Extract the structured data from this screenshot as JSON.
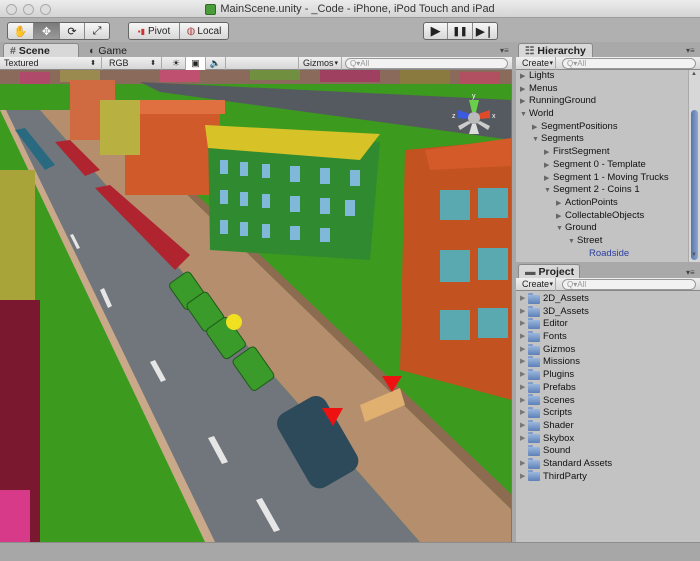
{
  "window": {
    "title": "MainScene.unity - _Code - iPhone, iPod Touch and iPad"
  },
  "toolbar": {
    "tools": [
      {
        "name": "hand-tool",
        "icon": "✋",
        "active": false
      },
      {
        "name": "move-tool",
        "icon": "✥",
        "active": true
      },
      {
        "name": "rotate-tool",
        "icon": "⟳",
        "active": false
      },
      {
        "name": "scale-tool",
        "icon": "⤢",
        "active": false
      }
    ],
    "pivot_label": "Pivot",
    "local_label": "Local",
    "play_icon": "▶",
    "pause_icon": "❚❚",
    "step_icon": "▶❘"
  },
  "scene_panel": {
    "tabs": [
      {
        "label": "Scene",
        "icon": "#",
        "active": true
      },
      {
        "label": "Game",
        "icon": "◐",
        "active": false
      }
    ],
    "render_mode": "Textured",
    "color_mode": "RGB",
    "gizmos_label": "Gizmos",
    "search_placeholder": "Q▾All",
    "gizmo_axes": {
      "y": "y",
      "x": "x",
      "z": "z"
    }
  },
  "hierarchy": {
    "tab_label": "Hierarchy",
    "create_label": "Create",
    "search_placeholder": "Q▾All",
    "items": [
      {
        "label": "Lights",
        "depth": 0,
        "expand": "collapsed"
      },
      {
        "label": "Menus",
        "depth": 0,
        "expand": "collapsed"
      },
      {
        "label": "RunningGround",
        "depth": 0,
        "expand": "collapsed"
      },
      {
        "label": "World",
        "depth": 0,
        "expand": "expanded"
      },
      {
        "label": "SegmentPositions",
        "depth": 1,
        "expand": "collapsed"
      },
      {
        "label": "Segments",
        "depth": 1,
        "expand": "expanded"
      },
      {
        "label": "FirstSegment",
        "depth": 2,
        "expand": "collapsed"
      },
      {
        "label": "Segment 0 - Template",
        "depth": 2,
        "expand": "collapsed"
      },
      {
        "label": "Segment 1 - Moving Trucks",
        "depth": 2,
        "expand": "collapsed"
      },
      {
        "label": "Segment 2 - Coins 1",
        "depth": 2,
        "expand": "expanded"
      },
      {
        "label": "ActionPoints",
        "depth": 3,
        "expand": "collapsed"
      },
      {
        "label": "CollectableObjects",
        "depth": 3,
        "expand": "collapsed"
      },
      {
        "label": "Ground",
        "depth": 3,
        "expand": "expanded"
      },
      {
        "label": "Street",
        "depth": 4,
        "expand": "expanded"
      },
      {
        "label": "Roadside",
        "depth": 5,
        "expand": "none",
        "selected": true
      }
    ]
  },
  "project": {
    "tab_label": "Project",
    "create_label": "Create",
    "search_placeholder": "Q▾All",
    "folders": [
      {
        "label": "2D_Assets",
        "has_children": true
      },
      {
        "label": "3D_Assets",
        "has_children": true
      },
      {
        "label": "Editor",
        "has_children": true
      },
      {
        "label": "Fonts",
        "has_children": true
      },
      {
        "label": "Gizmos",
        "has_children": true
      },
      {
        "label": "Missions",
        "has_children": true
      },
      {
        "label": "Plugins",
        "has_children": true
      },
      {
        "label": "Prefabs",
        "has_children": true
      },
      {
        "label": "Scenes",
        "has_children": true
      },
      {
        "label": "Scripts",
        "has_children": true
      },
      {
        "label": "Shader",
        "has_children": true
      },
      {
        "label": "Skybox",
        "has_children": true
      },
      {
        "label": "Sound",
        "has_children": false
      },
      {
        "label": "Standard Assets",
        "has_children": true
      },
      {
        "label": "ThirdParty",
        "has_children": true
      }
    ]
  },
  "colors": {
    "selected_text": "#2a3fa0",
    "scrollbar_thumb": "#6d88bb",
    "grass": "#3c9a1e",
    "road": "#6e7478"
  }
}
